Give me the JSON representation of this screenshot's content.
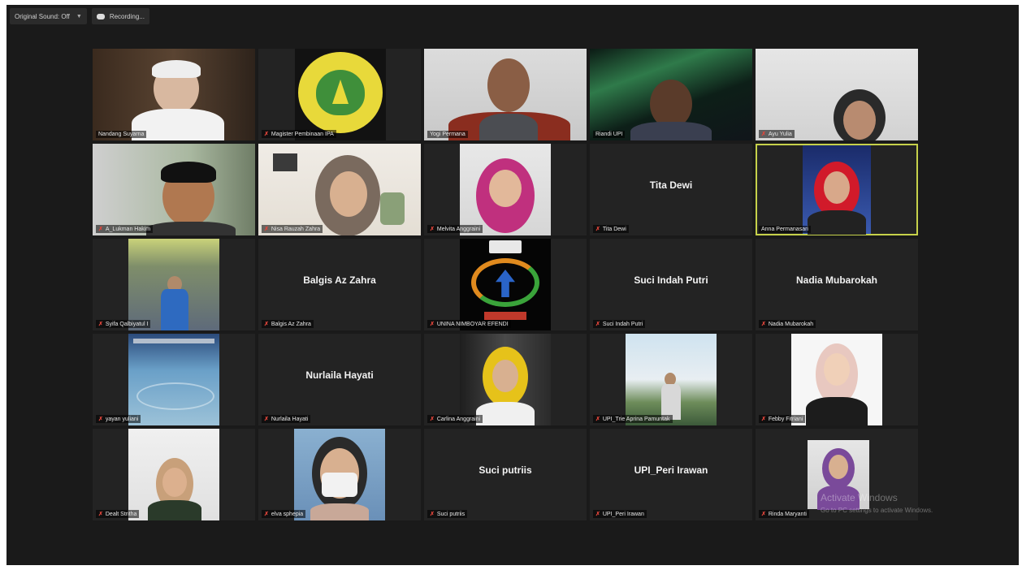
{
  "toolbar": {
    "sound_label": "Original Sound: Off",
    "sound_chevron": "chevron-down-icon",
    "recording_label": "Recording..."
  },
  "participants": [
    {
      "name": "Nandang Suyarna"
    },
    {
      "name": "Magister Pembinaan IPA"
    },
    {
      "name": "Yogi Permana"
    },
    {
      "name": "Riandi UPI"
    },
    {
      "name": "Ayu Yulia"
    },
    {
      "name": "A_Lukman Hakim"
    },
    {
      "name": "Nisa Rauzah Zahra"
    },
    {
      "name": "Melvita Anggraini"
    },
    {
      "name": "Tita Dewi",
      "display_name": "Tita Dewi"
    },
    {
      "name": "Anna Permanasari"
    },
    {
      "name": "Syifa Qalbiyatul I"
    },
    {
      "name": "Balgis Az Zahra",
      "display_name": "Balgis Az Zahra"
    },
    {
      "name": "UNINA NIMBOYAR EFENDI"
    },
    {
      "name": "Suci Indah Putri",
      "display_name": "Suci Indah Putri"
    },
    {
      "name": "Nadia Mubarokah",
      "display_name": "Nadia Mubarokah"
    },
    {
      "name": "yayan yuliani"
    },
    {
      "name": "Nurlaila Hayati",
      "display_name": "Nurlaila Hayati"
    },
    {
      "name": "Carlina Anggraini"
    },
    {
      "name": "UPI_Trie Aprina Pamuntak"
    },
    {
      "name": "Febby Fitriani"
    },
    {
      "name": "Dealt Stritha"
    },
    {
      "name": "elva sphepia"
    },
    {
      "name": "Suci putriis",
      "display_name": "Suci putriis"
    },
    {
      "name": "UPI_Peri Irawan",
      "display_name": "UPI_Peri Irawan"
    },
    {
      "name": "Rinda Maryanti"
    }
  ],
  "watermark": {
    "title": "Activate Windows",
    "subtitle": "Go to PC settings to activate Windows."
  },
  "colors": {
    "active_border": "#c6d14a",
    "muted_mic": "#e0453b",
    "tile_bg": "#232323"
  }
}
